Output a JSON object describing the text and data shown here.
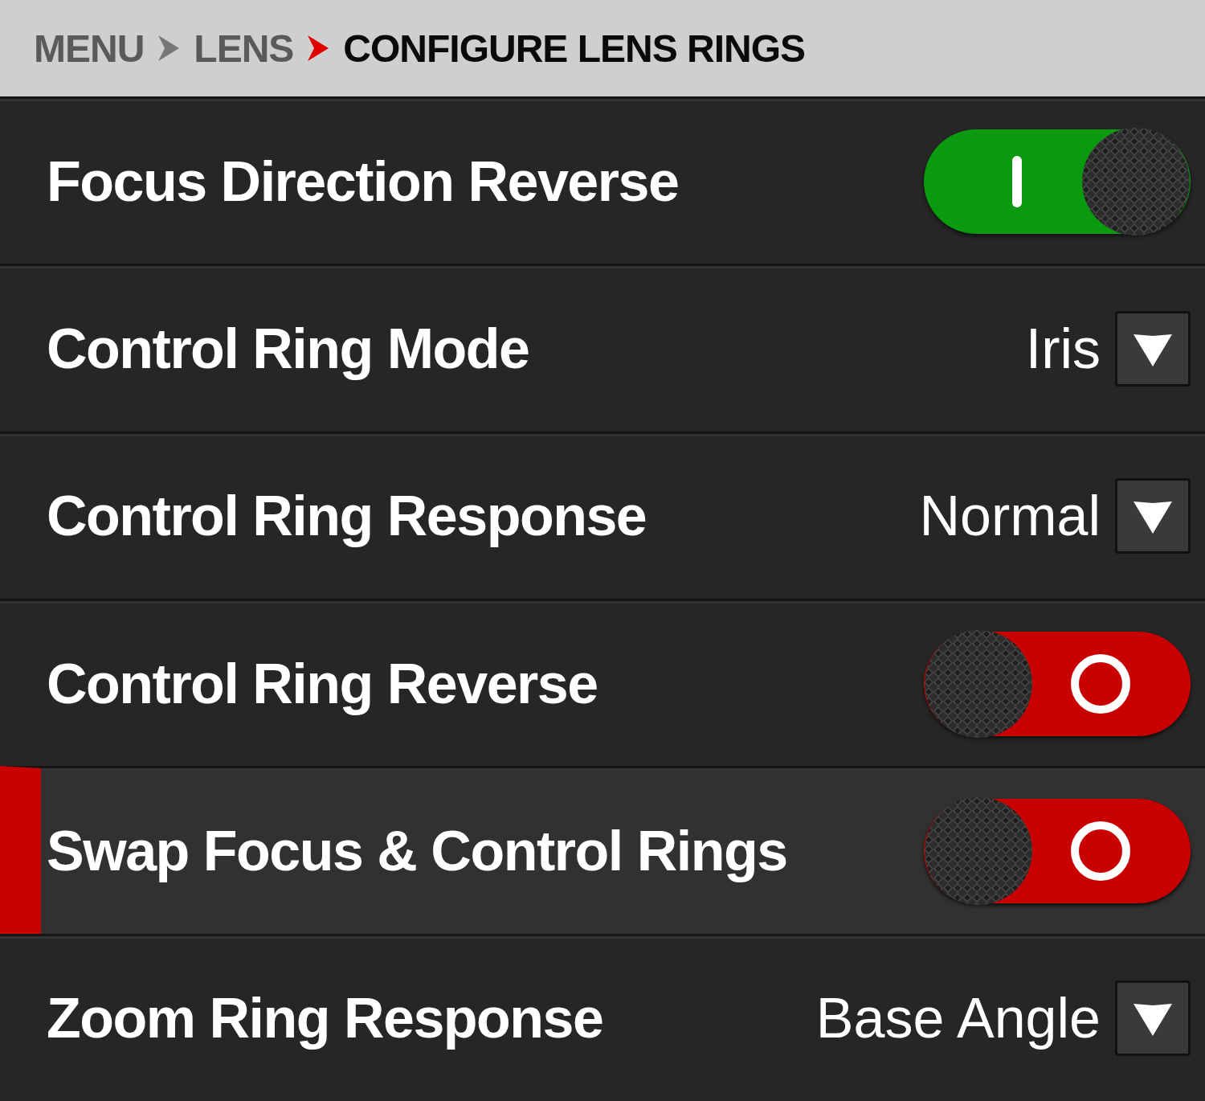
{
  "breadcrumb": [
    {
      "label": "MENU",
      "current": false
    },
    {
      "label": "LENS",
      "current": false
    },
    {
      "label": "CONFIGURE LENS RINGS",
      "current": true
    }
  ],
  "rows": [
    {
      "kind": "toggle",
      "label": "Focus Direction Reverse",
      "on": true,
      "selected": false
    },
    {
      "kind": "dropdown",
      "label": "Control Ring Mode",
      "value": "Iris",
      "selected": false
    },
    {
      "kind": "dropdown",
      "label": "Control Ring Response",
      "value": "Normal",
      "selected": false
    },
    {
      "kind": "toggle",
      "label": "Control Ring Reverse",
      "on": false,
      "selected": false
    },
    {
      "kind": "toggle",
      "label": "Swap Focus & Control Rings",
      "on": false,
      "selected": true
    },
    {
      "kind": "dropdown",
      "label": "Zoom Ring Response",
      "value": "Base Angle",
      "selected": false
    }
  ]
}
